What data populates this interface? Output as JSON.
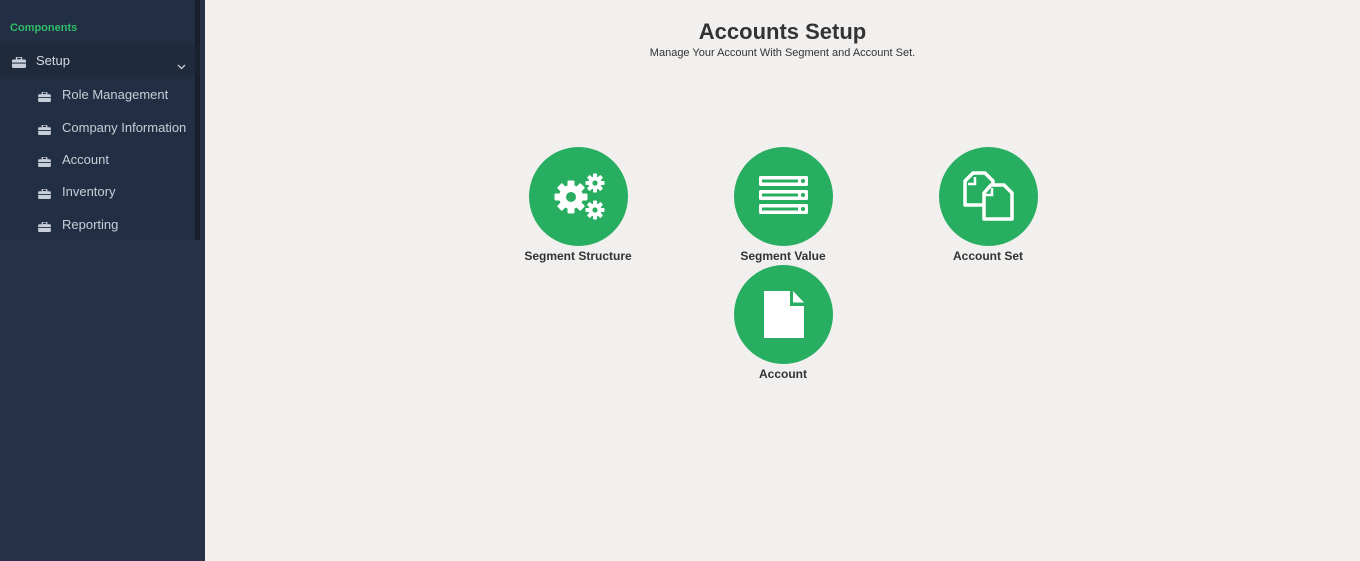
{
  "sidebar": {
    "section_title": "Components",
    "group": {
      "label": "Setup",
      "icon": "briefcase-icon",
      "expanded": true
    },
    "items": [
      {
        "label": "Role Management",
        "icon": "briefcase-icon"
      },
      {
        "label": "Company Information",
        "icon": "briefcase-icon"
      },
      {
        "label": "Account",
        "icon": "briefcase-icon"
      },
      {
        "label": "Inventory",
        "icon": "briefcase-icon"
      },
      {
        "label": "Reporting",
        "icon": "briefcase-icon"
      }
    ]
  },
  "page": {
    "title": "Accounts Setup",
    "subtitle": "Manage Your Account With Segment and Account Set."
  },
  "tiles": [
    {
      "label": "Segment Structure",
      "icon": "gears-icon"
    },
    {
      "label": "Segment Value",
      "icon": "server-list-icon"
    },
    {
      "label": "Account Set",
      "icon": "copy-files-icon"
    },
    {
      "label": "Account",
      "icon": "file-icon"
    }
  ],
  "colors": {
    "accent": "#27ae60",
    "sidebar_bg": "#26334a",
    "sidebar_menu_bg": "#222e43",
    "section_title": "#2fbd67",
    "page_bg": "#f2f0ee"
  }
}
